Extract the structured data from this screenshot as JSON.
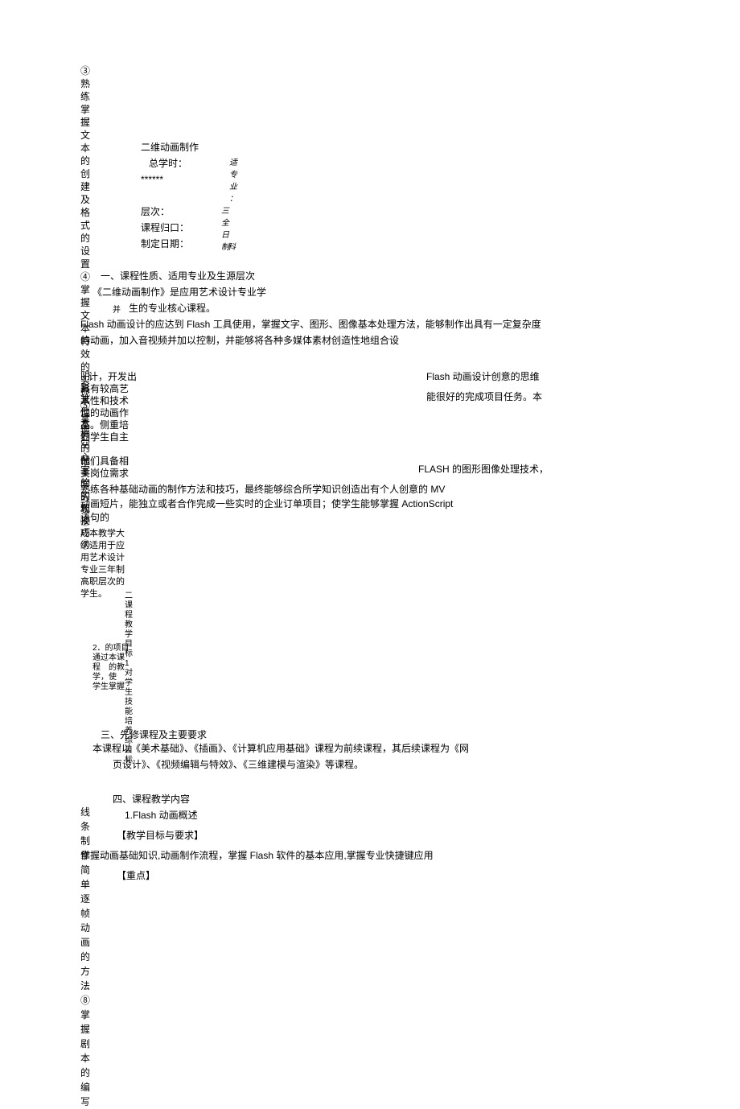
{
  "header": {
    "title": "二维动画制作",
    "total_hours_label": "总学时：",
    "stars": "******",
    "level_label": "层次：",
    "course_dept_label": "课程归口：",
    "date_label": "制定日期："
  },
  "right_col": {
    "r1": "适",
    "r2": "专",
    "r3": "业",
    "r4": "：",
    "r5": "三",
    "r6": "全",
    "r7": "日",
    "r8": "制",
    "r9": "科"
  },
  "left_vertical": {
    "a": "③熟练掌握文本的创建及格式的设置④掌握文本特效的实现⑤掌握空心字的实现⑥",
    "b": "阴　影其他本们的品孝学的　和技巧⑦",
    "c": "线条制作简单逐帧动画的方法⑧掌握剧本的编写"
  },
  "sections": {
    "s1_title": "一、课程性质、适用专业及生源层次",
    "s1_line1": "《二维动画制作》是应用艺术设计专业学",
    "s1_line2": "生的专业核心课程。",
    "s1_line3": "Flash 动画设计的应达到 Flash 工具使用，掌握文字、图形、图像基本处理方法，能够制作出具有一定复杂度",
    "s1_line4": "的动画，加入音视频并加以控制，并能够将各种多媒体素材创造性地组合设",
    "s1_line5": "计，开发出",
    "s1_line6": "具有较高艺",
    "s1_line7": "术性和技术",
    "s1_line8": "性的动画作",
    "s1_line9": "品。侧重培",
    "s1_line10": "养学生自主",
    "s1_right1": "Flash 动画设计创意的思维",
    "s1_right2": "能很好的完成项目任务。本",
    "s1_line11": "他们具备相",
    "s1_line12": "关岗位需求",
    "s1_right3": "FLASH 的图形图像处理技术，",
    "s1_line13": "熟练各种基础动画的制作方法和技巧，最终能够综合所学知识创造出有个人创意的 MV",
    "s1_line14": "动画短片，能独立或者合作完成一些实时的企业订单项目；使学生能够掌握 ActionScript",
    "s1_line15": "语句的",
    "s1_line16a": "成本教学大",
    "s1_line16b": "纲适用于应",
    "s1_line17": "用艺术设计",
    "s1_line18": "专业三年制",
    "s1_line19": "高职层次的",
    "s1_line20": "学生。",
    "v_col": "二课程教学目标1对学生技能培养综目标",
    "s2_title": "二、课程教学目标",
    "s2_sub": "2．的项目　通过本课程　的教学，使　学生掌握",
    "s3_title": "三、先修课程及主要要求",
    "s3_line1": "本课程以《美术基础》、《插画》、《计算机应用基础》课程为前续课程，其后续课程为《网",
    "s3_line2": "页设计》、《视频编辑与特效》、《三维建模与渲染》等课程。",
    "s4_title": "四、课程教学内容",
    "s4_sub1": "1.Flash 动画概述",
    "s4_label1": "【教学目标与要求】",
    "s4_line1": "掌握动画基础知识,动画制作流程，掌握 Flash 软件的基本应用,掌握专业快捷键应用",
    "s4_label2": "【重点】"
  }
}
